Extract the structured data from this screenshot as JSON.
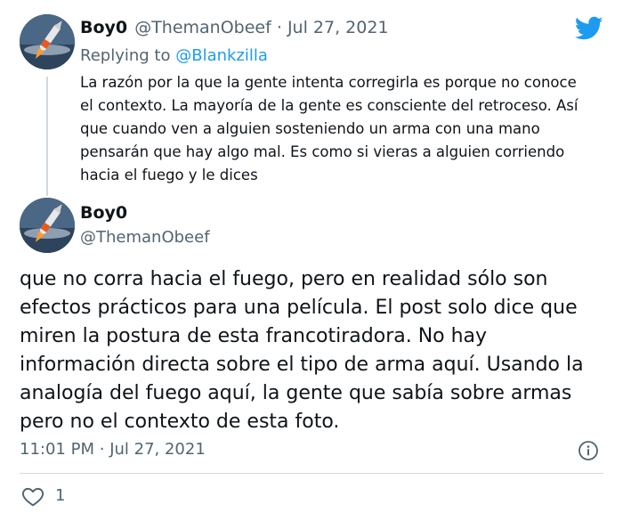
{
  "reply_tweet": {
    "author_name": "Boy0",
    "handle": "@ThemanObeef",
    "separator": "·",
    "date": "Jul 27, 2021",
    "replying_prefix": "Replying to",
    "replying_to": "@Blankzilla",
    "text": "La razón por la que la gente intenta corregirla es porque no conoce el contexto. La mayoría de la gente es consciente del retroceso. Así que cuando ven a alguien sosteniendo un arma con una mano pensarán que hay algo mal. Es como si vieras a alguien corriendo hacia el fuego y le dices"
  },
  "main_tweet": {
    "author_name": "Boy0",
    "handle": "@ThemanObeef",
    "text": "que no corra hacia el fuego, pero en realidad sólo son efectos prácticos para una película. El post solo dice que miren la postura de esta francotiradora. No hay información directa sobre el tipo de arma aquí. Usando la analogía del fuego aquí, la gente que sabía sobre armas pero no el contexto de esta foto.",
    "time": "11:01 PM",
    "separator": "·",
    "date": "Jul 27, 2021",
    "like_count": "1"
  },
  "icons": {
    "brand": "twitter-bird-icon",
    "info": "info-icon",
    "like": "heart-icon"
  },
  "colors": {
    "twitter_blue": "#1d9bf0",
    "muted_text": "#536471",
    "divider": "#cfd9de"
  }
}
